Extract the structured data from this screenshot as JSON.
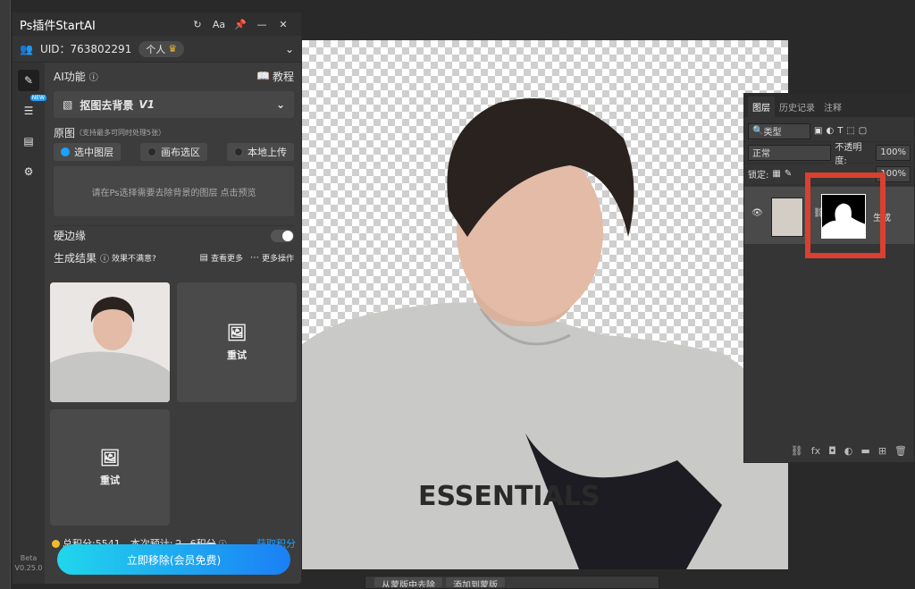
{
  "plugin": {
    "title": "Ps插件StartAI",
    "icon_refresh": "refresh-icon",
    "icon_font": "Aa",
    "uid": "UID：763802291",
    "account": "个人",
    "ai_label": "AI功能",
    "tutorial": "教程",
    "feature": "抠图去背景",
    "feature_version": "V1",
    "source_label": "原图",
    "source_hint": "（支持最多可同时处理5张）",
    "options": [
      "选中图层",
      "画布选区",
      "本地上传"
    ],
    "prompt": "请在Ps选择需要去除背景的图层",
    "prompt_link": "点击预览",
    "hard_edge": "硬边缘",
    "results_label": "生成结果",
    "unsatisfied": "效果不满意?",
    "see_more": "查看更多",
    "more_actions": "更多操作",
    "retry": "重试",
    "points": "总积分:5541",
    "estimate_label": "本次预计:",
    "estimate_value": "2~6积分",
    "get_points": "获取积分",
    "cta": "立即移除(会员免费)",
    "new_tag": "NEW",
    "beta": "Beta",
    "version": "V0.25.0"
  },
  "layers": {
    "tabs": [
      "图层",
      "历史记录",
      "注释"
    ],
    "kind": "类型",
    "blend": "正常",
    "opacity_label": "不透明度:",
    "opacity": "100%",
    "lock_label": "锁定:",
    "fill": "100%",
    "layer_name": "生成"
  },
  "bottom": {
    "items": [
      "从蒙版中去除",
      "添加到蒙版"
    ]
  },
  "colors": {
    "accent": "#1ea0ff",
    "highlight": "#d94030",
    "points_dot": "#f5b82e"
  }
}
